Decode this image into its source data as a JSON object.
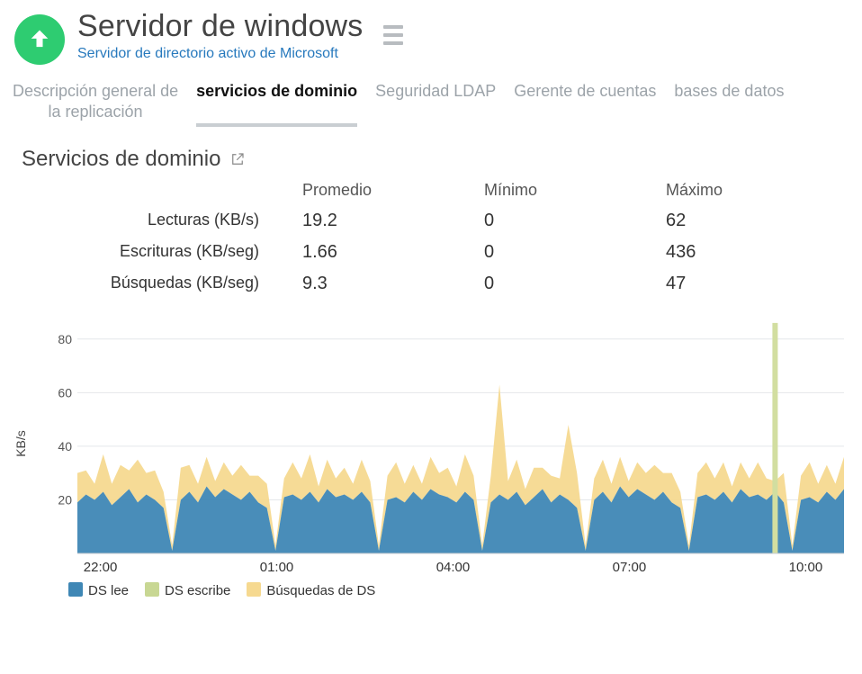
{
  "header": {
    "title": "Servidor de windows",
    "subtitle": "Servidor de directorio activo de Microsoft"
  },
  "tabs": [
    {
      "label": "Descripción general de\nla replicación",
      "active": false
    },
    {
      "label": "servicios de dominio",
      "active": true
    },
    {
      "label": "Seguridad LDAP",
      "active": false
    },
    {
      "label": "Gerente de cuentas",
      "active": false
    },
    {
      "label": "bases de datos",
      "active": false
    }
  ],
  "section": {
    "title": "Servicios de dominio"
  },
  "stats": {
    "columns": [
      "Promedio",
      "Mínimo",
      "Máximo"
    ],
    "rows": [
      {
        "label": "Lecturas (KB/s)",
        "avg": "19.2",
        "min": "0",
        "max": "62"
      },
      {
        "label": "Escrituras (KB/seg)",
        "avg": "1.66",
        "min": "0",
        "max": "436"
      },
      {
        "label": "Búsquedas (KB/seg)",
        "avg": "9.3",
        "min": "0",
        "max": "47"
      }
    ]
  },
  "legend": {
    "blue": "DS lee",
    "green": "DS escribe",
    "yellow": "Búsquedas de DS"
  },
  "chart_data": {
    "type": "area",
    "stacked": true,
    "ylabel": "KB/s",
    "ylim": [
      0,
      90
    ],
    "yticks": [
      20,
      40,
      60,
      80
    ],
    "x_categories": [
      "22:00",
      "01:00",
      "04:00",
      "07:00",
      "10:00"
    ],
    "n_points": 90,
    "series": [
      {
        "name": "DS lee",
        "color": "#3f87b5",
        "values": [
          19,
          22,
          20,
          23,
          18,
          21,
          24,
          19,
          22,
          20,
          17,
          1,
          20,
          23,
          19,
          25,
          21,
          24,
          22,
          20,
          23,
          19,
          17,
          1,
          21,
          22,
          20,
          23,
          19,
          24,
          21,
          22,
          20,
          23,
          19,
          1,
          20,
          21,
          19,
          23,
          20,
          24,
          22,
          21,
          19,
          23,
          20,
          1,
          19,
          22,
          20,
          23,
          18,
          21,
          24,
          19,
          22,
          20,
          17,
          1,
          20,
          23,
          19,
          25,
          21,
          24,
          22,
          20,
          23,
          19,
          17,
          1,
          21,
          22,
          20,
          23,
          19,
          24,
          21,
          22,
          20,
          23,
          19,
          1,
          20,
          21,
          19,
          23,
          20,
          24
        ]
      },
      {
        "name": "DS escribe",
        "color": "#c8d793",
        "values": [
          0,
          0,
          0,
          0,
          0,
          0,
          0,
          0,
          0,
          0,
          0,
          0,
          0,
          0,
          0,
          0,
          0,
          0,
          0,
          0,
          0,
          0,
          0,
          0,
          0,
          0,
          0,
          0,
          0,
          0,
          0,
          0,
          0,
          0,
          0,
          0,
          0,
          0,
          0,
          0,
          0,
          0,
          0,
          0,
          0,
          0,
          0,
          0,
          0,
          0,
          0,
          0,
          0,
          0,
          0,
          0,
          0,
          0,
          0,
          0,
          0,
          0,
          0,
          0,
          0,
          0,
          0,
          0,
          0,
          0,
          0,
          0,
          0,
          0,
          0,
          0,
          0,
          0,
          0,
          0,
          0,
          86,
          0,
          0,
          0,
          0,
          0,
          0,
          0,
          0
        ]
      },
      {
        "name": "Búsquedas de DS",
        "color": "#f6d990",
        "values": [
          11,
          9,
          6,
          14,
          8,
          12,
          7,
          16,
          8,
          11,
          6,
          2,
          12,
          10,
          7,
          11,
          6,
          10,
          7,
          13,
          6,
          10,
          9,
          2,
          7,
          12,
          8,
          14,
          6,
          11,
          7,
          10,
          6,
          12,
          8,
          2,
          9,
          13,
          7,
          10,
          6,
          12,
          8,
          11,
          6,
          14,
          9,
          2,
          10,
          41,
          7,
          12,
          6,
          11,
          8,
          10,
          6,
          28,
          13,
          2,
          8,
          12,
          7,
          11,
          6,
          10,
          8,
          13,
          7,
          11,
          6,
          2,
          9,
          12,
          8,
          11,
          6,
          10,
          7,
          12,
          8,
          4,
          11,
          2,
          9,
          13,
          7,
          10,
          6,
          12
        ]
      }
    ],
    "annotations": [
      {
        "type": "spike",
        "series": "DS escribe",
        "x_index": 81,
        "value": 86
      }
    ]
  }
}
